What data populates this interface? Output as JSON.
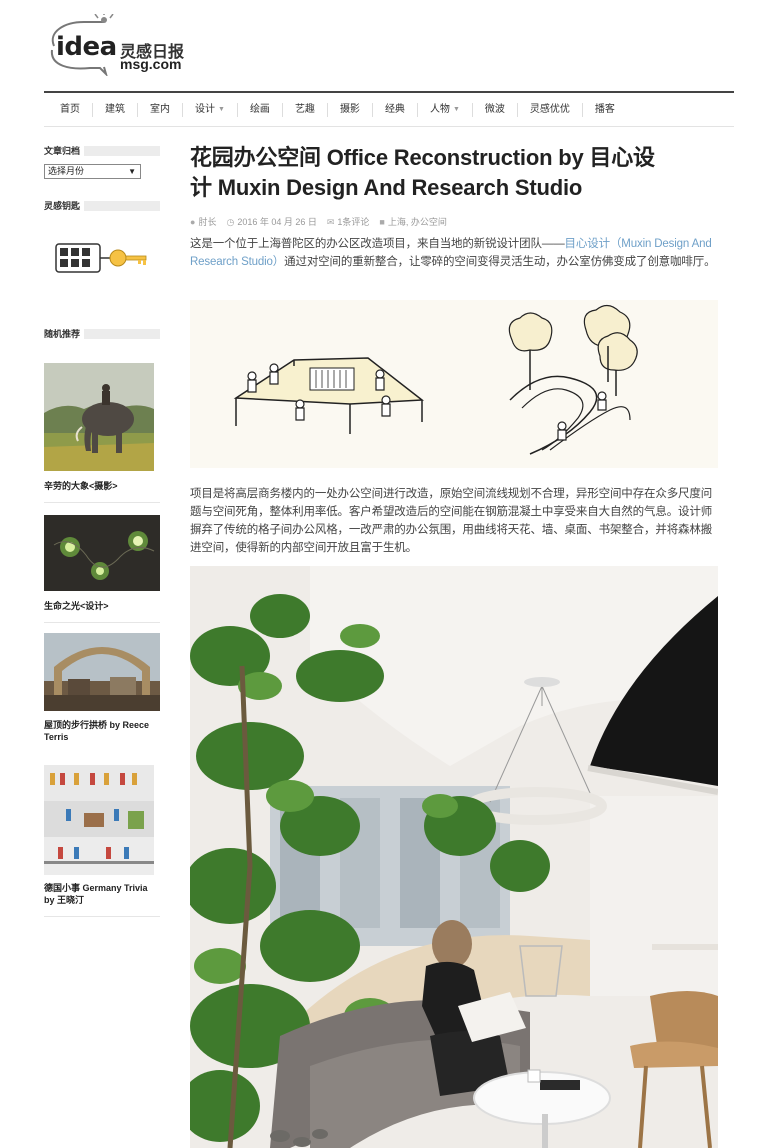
{
  "site": {
    "logo_word": "idea",
    "logo_cn": "灵感日报",
    "logo_domain": "msg.com"
  },
  "nav": {
    "items": [
      {
        "label": "首页"
      },
      {
        "label": "建筑"
      },
      {
        "label": "室内"
      },
      {
        "label": "设计",
        "has_dropdown": true
      },
      {
        "label": "绘画"
      },
      {
        "label": "艺趣"
      },
      {
        "label": "摄影"
      },
      {
        "label": "经典"
      },
      {
        "label": "人物",
        "has_dropdown": true
      },
      {
        "label": "微波"
      },
      {
        "label": "灵感优优"
      },
      {
        "label": "播客"
      }
    ]
  },
  "sidebar": {
    "archive_heading": "文章归档",
    "month_select_value": "选择月份",
    "keychain_heading": "灵感钥匙",
    "random_heading": "随机推荐",
    "cards": [
      {
        "title_line1": "辛劳的大象<摄影>",
        "title_line2": ""
      },
      {
        "title_line1": "生命之光<设计>",
        "title_line2": ""
      },
      {
        "title_line1": "屋顶的步行拱桥 by Reece",
        "title_line2": "Terris"
      },
      {
        "title_line1": "德国小事 Germany Trivia",
        "title_line2": "by 王晓汀"
      }
    ]
  },
  "article": {
    "title_line1": "花园办公空间 Office Reconstruction by 目心设",
    "title_line2": "计 Muxin Design And Research Studio",
    "meta": {
      "author": "肘长",
      "date": "2016 年 04 月 26 日",
      "comments": "1条评论",
      "tags": "上海, 办公空间"
    },
    "intro_before": "这是一个位于上海普陀区的办公区改造项目，来自当地的新锐设计团队——",
    "intro_link": "目心设计（Muxin Design And Research Studio）",
    "intro_after": "通过对空间的重新整合，让零碎的空间变得灵活生动，办公室仿佛变成了创意咖啡厅。",
    "body": "项目是将高层商务楼内的一处办公空间进行改造，原始空间流线规划不合理，异形空间中存在众多尺度问题与空间死角，整体利用率低。客户希望改造后的空间能在钢筋混凝土中享受来自大自然的气息。设计师摒弃了传统的格子间办公风格，一改严肃的办公氛围，用曲线将天花、墙、桌面、书架整合，并将森林搬进空间，使得新的内部空间开放且富于生机。"
  },
  "colors": {
    "link": "#6fa0c8",
    "nav_rule": "#444444",
    "sidebar_rule": "#ececec"
  }
}
